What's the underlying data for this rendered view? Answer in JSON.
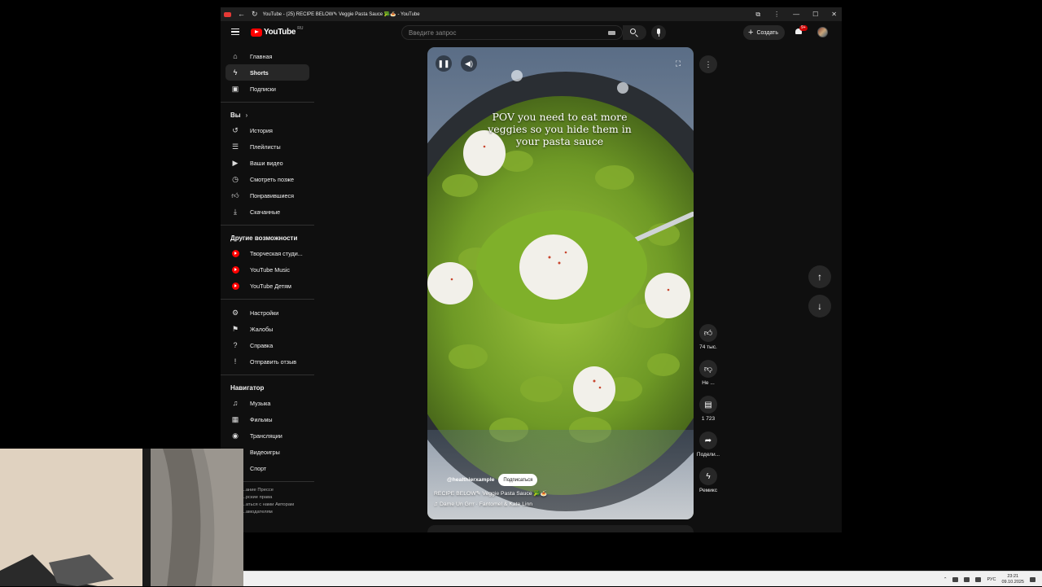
{
  "window": {
    "title": "YouTube - (25) RECIPE BELOW✎ Veggie Pasta Sauce 🥦🍝 - YouTube",
    "controls": [
      "—",
      "☐",
      "✕"
    ]
  },
  "header": {
    "logo_text": "YouTube",
    "logo_region": "RU",
    "search_placeholder": "Введите запрос",
    "create_label": "Создать",
    "notif_badge": "9+"
  },
  "sidebar": {
    "main": [
      {
        "label": "Главная",
        "icon": "home-icon"
      },
      {
        "label": "Shorts",
        "icon": "shorts-icon",
        "active": true
      },
      {
        "label": "Подписки",
        "icon": "subscriptions-icon"
      }
    ],
    "you_heading": "Вы",
    "you": [
      {
        "label": "История",
        "icon": "history-icon"
      },
      {
        "label": "Плейлисты",
        "icon": "playlists-icon"
      },
      {
        "label": "Ваши видео",
        "icon": "your-videos-icon"
      },
      {
        "label": "Смотреть позже",
        "icon": "watch-later-icon"
      },
      {
        "label": "Понравившиеся",
        "icon": "liked-icon"
      },
      {
        "label": "Скачанные",
        "icon": "downloads-icon"
      }
    ],
    "more_heading": "Другие возможности",
    "more": [
      {
        "label": "Творческая студи...",
        "icon": "studio-icon"
      },
      {
        "label": "YouTube Music",
        "icon": "yt-music-icon"
      },
      {
        "label": "YouTube Детям",
        "icon": "yt-kids-icon"
      }
    ],
    "settings": [
      {
        "label": "Настройки",
        "icon": "settings-icon"
      },
      {
        "label": "Жалобы",
        "icon": "flag-icon"
      },
      {
        "label": "Справка",
        "icon": "help-icon"
      },
      {
        "label": "Отправить отзыв",
        "icon": "feedback-icon"
      }
    ],
    "nav_heading": "Навигатор",
    "navigator": [
      {
        "label": "Музыка",
        "icon": "music-icon"
      },
      {
        "label": "Фильмы",
        "icon": "movies-icon"
      },
      {
        "label": "Трансляции",
        "icon": "live-icon"
      },
      {
        "label": "Видеоигры",
        "icon": "gaming-icon"
      },
      {
        "label": "Спорт",
        "icon": "sport-icon"
      }
    ],
    "footer_lines": [
      "...ание  Прессе",
      "...рские права",
      "...аться с нами  Авторам",
      "...амодателям"
    ]
  },
  "short": {
    "caption": "POV you need to eat more veggies so you hide them in your pasta sauce",
    "channel": "@healthierxample",
    "subscribe_label": "Подписаться",
    "title": "RECIPE BELOW✎ Veggie Pasta Sauce 🥦🍝",
    "music": "♫ Dame Un Grrr · Fantomel & Kate Linn"
  },
  "actions": {
    "likes": "74 тыс.",
    "dislike": "Не ...",
    "comments": "1 723",
    "share": "Подели...",
    "remix": "Ремикс"
  },
  "taskbar": {
    "lang": "РУС",
    "time": "23:21",
    "date": "09.10.2025"
  }
}
